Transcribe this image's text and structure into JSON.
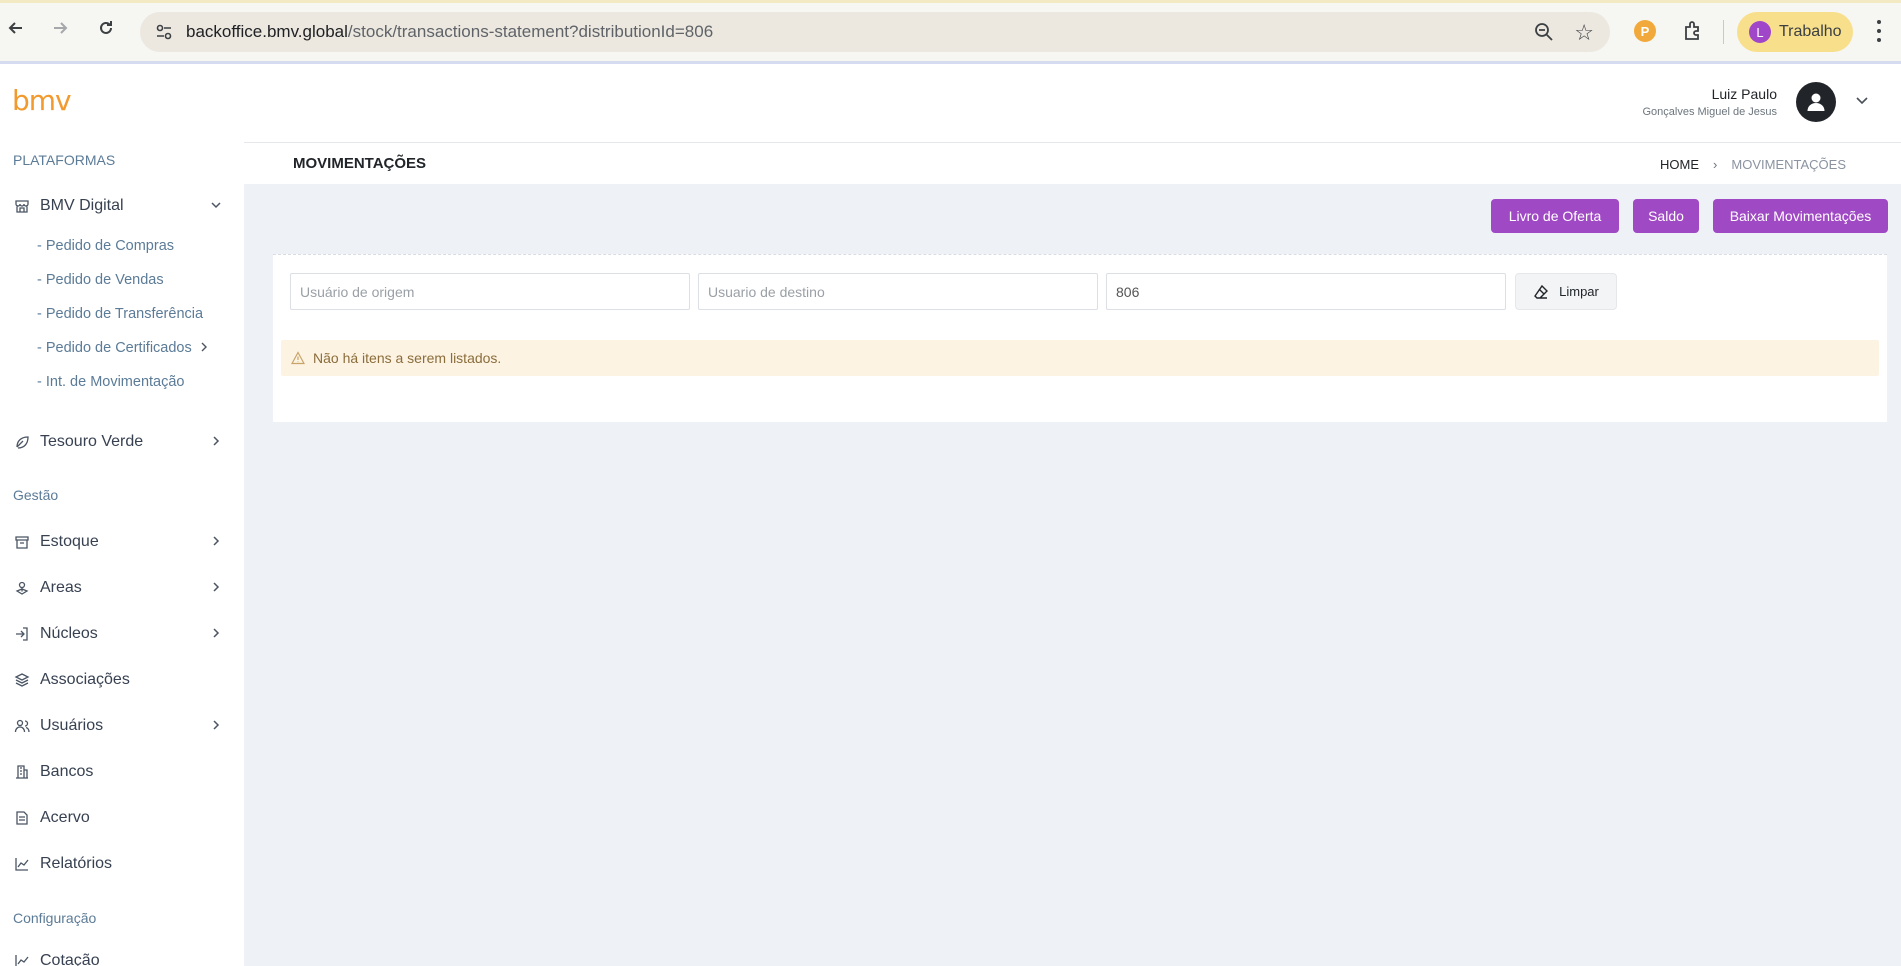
{
  "browser": {
    "url_host": "backoffice.bmv.global",
    "url_path": "/stock/transactions-statement?distributionId=806",
    "profile_initial": "L",
    "profile_label": "Trabalho"
  },
  "header": {
    "logo": "bmv",
    "user_name": "Luiz Paulo",
    "user_subtitle": "Gonçalves Miguel de Jesus"
  },
  "sidebar": {
    "section_platforms": "PLATAFORMAS",
    "bmv_digital": "BMV Digital",
    "sub_items": [
      "- Pedido de Compras",
      "- Pedido de Vendas",
      "- Pedido de Transferência",
      "- Pedido de Certificados",
      "- Int. de Movimentação"
    ],
    "tesouro_verde": "Tesouro Verde",
    "section_gestao": "Gestão",
    "gestao_items": [
      "Estoque",
      "Areas",
      "Núcleos",
      "Associações",
      "Usuários",
      "Bancos",
      "Acervo",
      "Relatórios"
    ],
    "section_config": "Configuração",
    "config_items": [
      "Cotação"
    ]
  },
  "page": {
    "title": "MOVIMENTAÇÕES",
    "breadcrumb_home": "HOME",
    "breadcrumb_sep": "›",
    "breadcrumb_current": "MOVIMENTAÇÕES"
  },
  "actions": {
    "livro": "Livro de Oferta",
    "saldo": "Saldo",
    "baixar": "Baixar Movimentações"
  },
  "filters": {
    "origem_placeholder": "Usuário de origem",
    "destino_placeholder": "Usuario de destino",
    "distribution_value": "806",
    "clear_label": "Limpar"
  },
  "empty_message": "Não há itens a serem listados.",
  "colors": {
    "accent": "#a049c4",
    "logo": "#f29a2e",
    "alert_bg": "#fdf3e3"
  }
}
